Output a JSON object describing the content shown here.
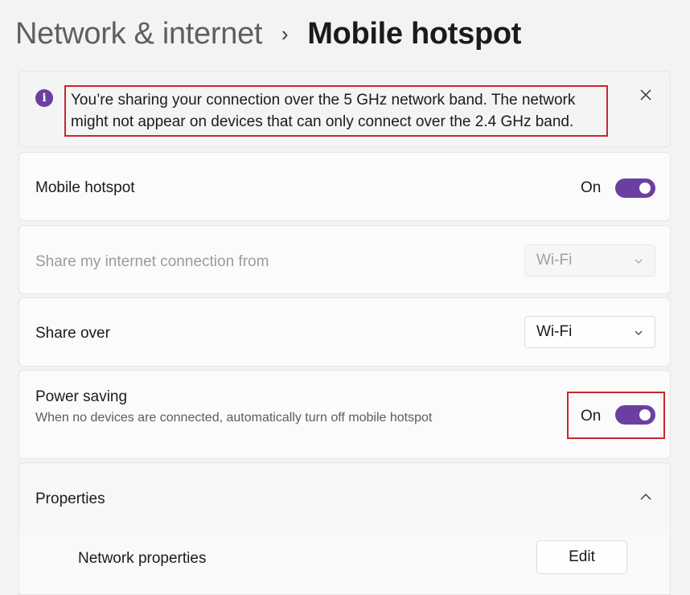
{
  "breadcrumb": {
    "parent": "Network & internet",
    "separator": "›",
    "current": "Mobile hotspot"
  },
  "info_bar": {
    "icon": "info-icon",
    "icon_glyph": "i",
    "message": "You’re sharing your connection over the 5 GHz network band. The network might not appear on devices that can only connect over the 2.4 GHz band."
  },
  "settings": {
    "mobile_hotspot": {
      "label": "Mobile hotspot",
      "state": "On",
      "enabled": true
    },
    "share_from": {
      "label": "Share my internet connection from",
      "value": "Wi-Fi",
      "disabled": true
    },
    "share_over": {
      "label": "Share over",
      "value": "Wi-Fi"
    },
    "power_saving": {
      "label": "Power saving",
      "description": "When no devices are connected, automatically turn off mobile hotspot",
      "state": "On",
      "enabled": true
    }
  },
  "properties": {
    "header": "Properties",
    "expanded": true,
    "network_properties": {
      "label": "Network properties",
      "button": "Edit"
    }
  },
  "colors": {
    "accent": "#6b3fa0",
    "highlight_border": "#c8272d",
    "background": "#f3f3f3"
  }
}
